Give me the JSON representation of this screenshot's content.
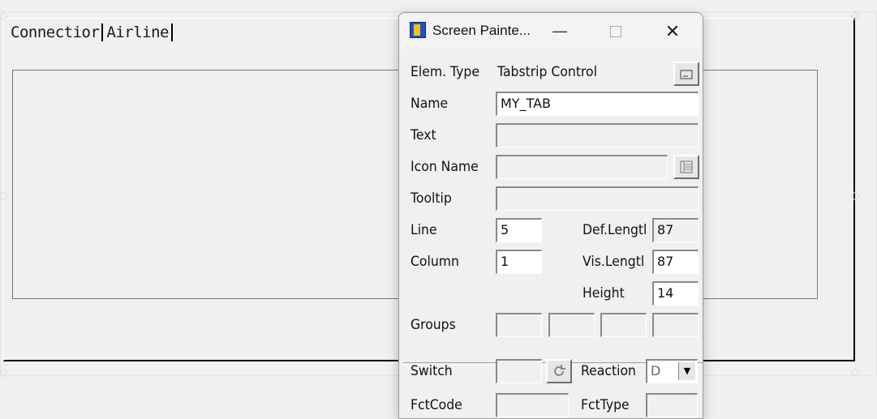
{
  "canvas": {
    "tabs": [
      {
        "label": "Connectior"
      },
      {
        "label": "Airline"
      }
    ]
  },
  "dialog": {
    "title": "Screen Painte...",
    "controls": {
      "minimize": "—",
      "maximize": "",
      "close": "✕"
    },
    "elem_type": {
      "label": "Elem. Type",
      "value": "Tabstrip Control",
      "icon": "window-button-icon"
    },
    "name": {
      "label": "Name",
      "value": "MY_TAB"
    },
    "text": {
      "label": "Text",
      "value": ""
    },
    "icon_name": {
      "label": "Icon Name",
      "value": "",
      "icon": "list-picker-icon"
    },
    "tooltip": {
      "label": "Tooltip",
      "value": ""
    },
    "line": {
      "label": "Line",
      "value": "5"
    },
    "column": {
      "label": "Column",
      "value": "1"
    },
    "def_length": {
      "label": "Def.Lengtl",
      "value": "87"
    },
    "vis_length": {
      "label": "Vis.Lengtl",
      "value": "87"
    },
    "height": {
      "label": "Height",
      "value": "14"
    },
    "groups": {
      "label": "Groups",
      "values": [
        "",
        "",
        "",
        ""
      ]
    },
    "switch": {
      "label": "Switch",
      "value": "",
      "icon": "refresh-icon"
    },
    "reaction": {
      "label": "Reaction",
      "value": "D"
    },
    "fct_code": {
      "label": "FctCode",
      "value": ""
    },
    "fct_type": {
      "label": "FctType",
      "value": ""
    }
  }
}
